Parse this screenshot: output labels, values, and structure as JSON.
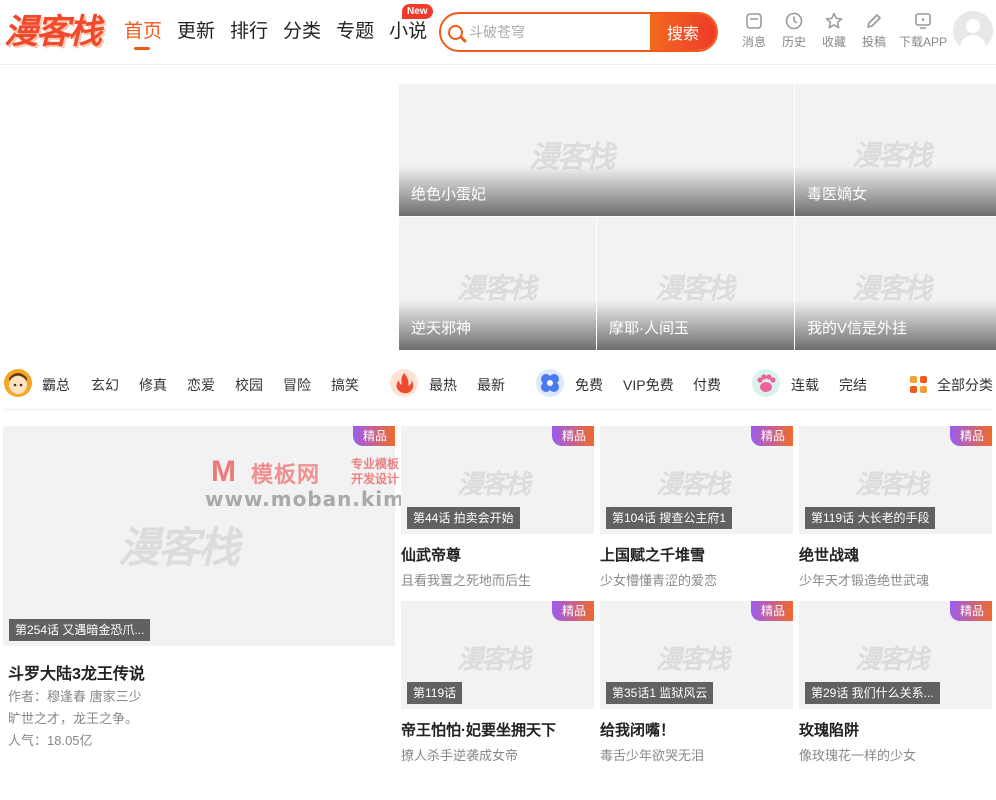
{
  "brand": {
    "logo_text": "漫客栈",
    "accent": "#f05a1a"
  },
  "nav": {
    "items": [
      {
        "label": "首页",
        "active": true
      },
      {
        "label": "更新"
      },
      {
        "label": "排行"
      },
      {
        "label": "分类"
      },
      {
        "label": "专题"
      },
      {
        "label": "小说"
      }
    ],
    "new_badge": "New"
  },
  "search": {
    "placeholder": "斗破苍穹",
    "button_label": "搜索"
  },
  "tools": [
    {
      "label": "消息",
      "icon": "message-icon"
    },
    {
      "label": "历史",
      "icon": "clock-icon"
    },
    {
      "label": "收藏",
      "icon": "star-icon"
    },
    {
      "label": "投稿",
      "icon": "pen-icon"
    },
    {
      "label": "下载APP",
      "icon": "download-icon"
    }
  ],
  "watermark_text": "漫客栈",
  "banner": [
    {
      "title": "绝色小蛋妃"
    },
    {
      "title": "毒医嫡女"
    },
    {
      "title": "逆天邪神"
    },
    {
      "title": "摩耶·人间玉"
    },
    {
      "title": "我的V信是外挂"
    }
  ],
  "categories": {
    "group1": [
      "霸总",
      "玄幻",
      "修真",
      "恋爱",
      "校园",
      "冒险",
      "搞笑"
    ],
    "group2": [
      "最热",
      "最新"
    ],
    "group3": [
      "免费",
      "VIP免费",
      "付费"
    ],
    "group4": [
      "连载",
      "完结"
    ],
    "all": "全部分类"
  },
  "site_watermark": {
    "line1": "M",
    "line2": "模板网",
    "line3": "专业模板 开发设计",
    "line4": "www.moban.kim"
  },
  "featured": {
    "tag": "精品",
    "episode": "第254话 又遇暗金恐爪...",
    "title": "斗罗大陆3龙王传说",
    "author": "作者：穆逢春 唐家三少",
    "desc": "旷世之才，龙王之争。",
    "popularity": "人气：18.05亿"
  },
  "cards": [
    {
      "tag": "精品",
      "episode": "第44话 拍卖会开始",
      "title": "仙武帝尊",
      "desc": "且看我置之死地而后生"
    },
    {
      "tag": "精品",
      "episode": "第104话 搜查公主府1",
      "title": "上国赋之千堆雪",
      "desc": "少女懵懂青涩的爱恋"
    },
    {
      "tag": "精品",
      "episode": "第119话 大长老的手段",
      "title": "绝世战魂",
      "desc": "少年天才锻造绝世武魂"
    },
    {
      "tag": "精品",
      "episode": "第119话",
      "title": "帝王怕怕·妃要坐拥天下",
      "desc": "撩人杀手逆袭成女帝"
    },
    {
      "tag": "精品",
      "episode": "第35话1 监狱风云",
      "title": "给我闭嘴！",
      "desc": "毒舌少年欲哭无泪"
    },
    {
      "tag": "精品",
      "episode": "第29话 我们什么关系...",
      "title": "玫瑰陷阱",
      "desc": "像玫瑰花一样的少女"
    }
  ]
}
